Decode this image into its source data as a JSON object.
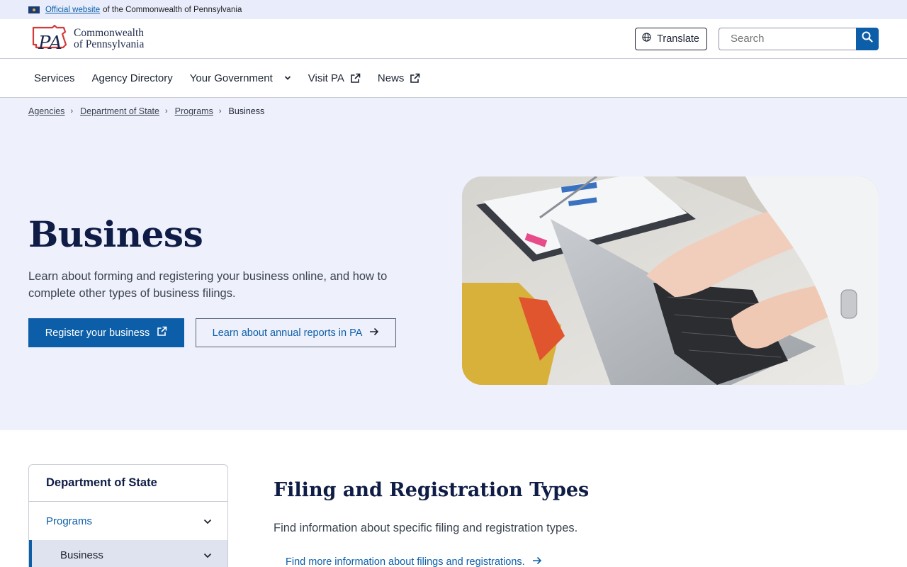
{
  "official_banner": {
    "link_text": "Official website",
    "rest_text": "of the Commonwealth of Pennsylvania"
  },
  "header": {
    "logo_line1": "Commonwealth",
    "logo_line2": "of Pennsylvania",
    "logo_mark_text": "PA",
    "translate_label": "Translate",
    "search_placeholder": "Search"
  },
  "nav": {
    "items": [
      {
        "label": "Services"
      },
      {
        "label": "Agency Directory"
      },
      {
        "label": "Your Government"
      },
      {
        "label": "Visit PA"
      },
      {
        "label": "News"
      }
    ]
  },
  "breadcrumb": {
    "items": [
      "Agencies",
      "Department of State",
      "Programs"
    ],
    "current": "Business"
  },
  "hero": {
    "title": "Business",
    "description": "Learn about forming and registering your business online, and how to complete other types of business filings.",
    "primary_button": "Register your business",
    "secondary_button": "Learn about annual reports in PA"
  },
  "sidebar": {
    "title": "Department of State",
    "items": [
      {
        "label": "Programs"
      },
      {
        "label": "Business"
      }
    ]
  },
  "main": {
    "section_title": "Filing and Registration Types",
    "section_desc": "Find information about specific filing and registration types.",
    "section_link": "Find more information about filings and registrations."
  },
  "colors": {
    "accent": "#0c5ea8",
    "heading": "#0f1c45",
    "hero_bg": "#eef0fc",
    "banner_bg": "#e9edfb"
  }
}
